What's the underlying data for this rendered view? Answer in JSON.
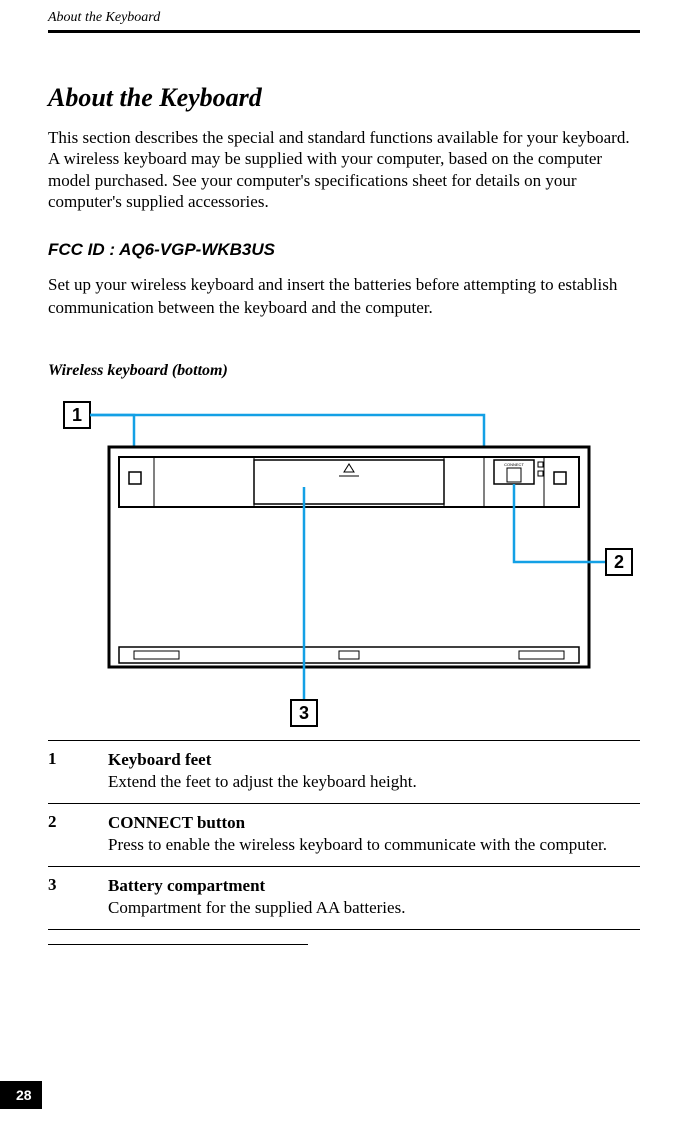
{
  "running_head": "About the Keyboard",
  "title": "About the Keyboard",
  "intro": "This section describes the special and standard functions available for your keyboard. A wireless keyboard may be supplied with your computer, based on the computer model purchased. See your computer's specifications sheet for details on your computer's supplied accessories.",
  "fcc_heading": "FCC ID : AQ6-VGP-WKB3US",
  "setup_text": "Set up your wireless keyboard and insert the batteries before attempting to establish communication between the keyboard and the computer.",
  "figure_caption": "Wireless keyboard (bottom)",
  "callouts": {
    "c1": "1",
    "c2": "2",
    "c3": "3"
  },
  "connect_label": "CONNECT",
  "legend": [
    {
      "n": "1",
      "title": "Keyboard feet",
      "text": "Extend the feet to adjust the keyboard height."
    },
    {
      "n": "2",
      "title": "CONNECT button",
      "text": "Press to enable the wireless keyboard to communicate with the computer."
    },
    {
      "n": "3",
      "title": "Battery compartment",
      "text": "Compartment for the supplied AA batteries."
    }
  ],
  "page_number": "28"
}
